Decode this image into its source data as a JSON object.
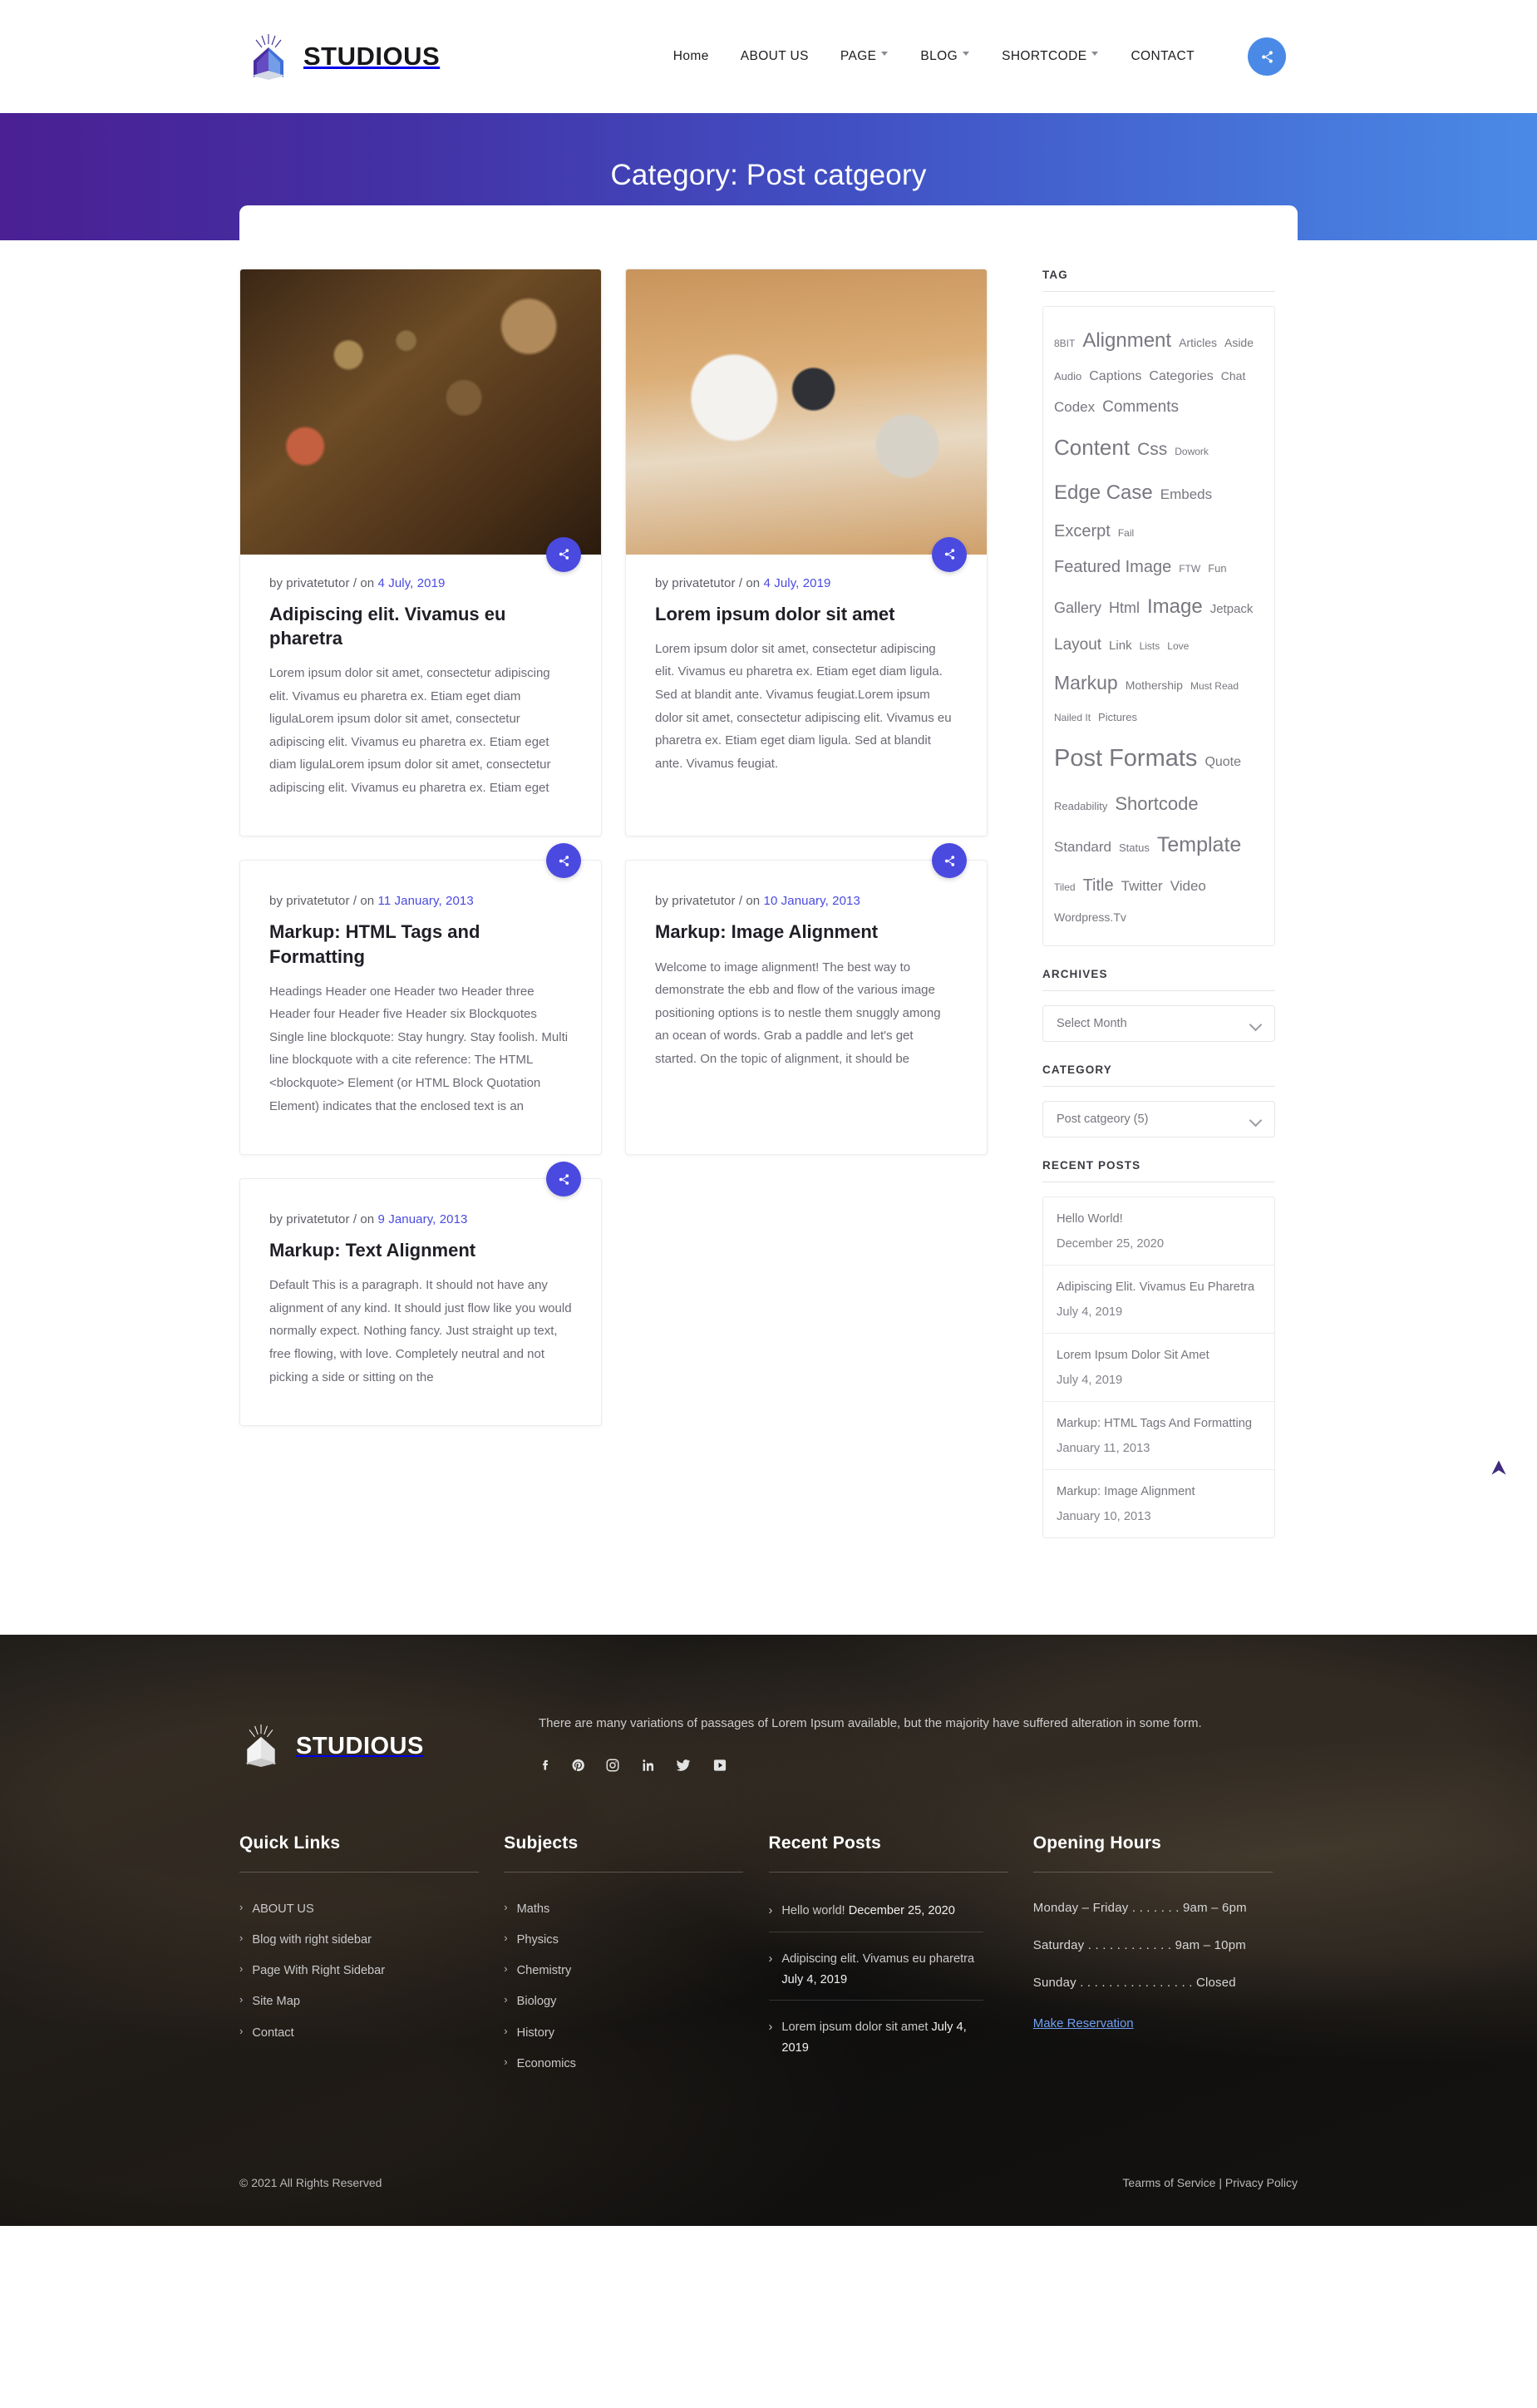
{
  "header": {
    "brand": "STUDIOUS",
    "nav": [
      {
        "label": "Home",
        "caret": false
      },
      {
        "label": "ABOUT US",
        "caret": false
      },
      {
        "label": "PAGE",
        "caret": true
      },
      {
        "label": "BLOG",
        "caret": true
      },
      {
        "label": "SHORTCODE",
        "caret": true
      },
      {
        "label": "CONTACT",
        "caret": false
      }
    ],
    "share_icon": "share-icon"
  },
  "hero": {
    "title": "Category: Post catgeory"
  },
  "posts": [
    {
      "meta_by": "by privatetutor / on ",
      "date": "4 July, 2019",
      "title": "Adipiscing elit. Vivamus eu pharetra",
      "excerpt": "Lorem ipsum dolor sit amet, consectetur adipiscing elit. Vivamus eu pharetra ex. Etiam eget diam ligulaLorem ipsum dolor sit amet, consectetur adipiscing elit. Vivamus eu pharetra ex. Etiam eget diam ligulaLorem ipsum dolor sit amet, consectetur adipiscing elit. Vivamus eu pharetra ex. Etiam eget",
      "has_image": true,
      "image_kind": "engine-room-photo"
    },
    {
      "meta_by": "by privatetutor / on ",
      "date": "4 July, 2019",
      "title": "Lorem ipsum dolor sit amet",
      "excerpt": "Lorem ipsum dolor sit amet, consectetur adipiscing elit. Vivamus eu pharetra ex. Etiam eget diam ligula. Sed at blandit ante. Vivamus feugiat.Lorem ipsum dolor sit amet, consectetur adipiscing elit. Vivamus eu pharetra ex. Etiam eget diam ligula. Sed at blandit ante. Vivamus feugiat.",
      "has_image": true,
      "image_kind": "desk-workspace-photo"
    },
    {
      "meta_by": "by privatetutor / on ",
      "date": "11 January, 2013",
      "title": "Markup: HTML Tags and Formatting",
      "excerpt": "Headings Header one Header two Header three Header four Header five Header six Blockquotes Single line blockquote: Stay hungry. Stay foolish. Multi line blockquote with a cite reference: The HTML <blockquote> Element (or HTML Block Quotation Element) indicates that the enclosed text is an",
      "has_image": false,
      "image_kind": ""
    },
    {
      "meta_by": "by privatetutor / on ",
      "date": "10 January, 2013",
      "title": "Markup: Image Alignment",
      "excerpt": "Welcome to image alignment! The best way to demonstrate the ebb and flow of the various image positioning options is to nestle them snuggly among an ocean of words. Grab a paddle and let's get started. On the topic of alignment, it should be",
      "has_image": false,
      "image_kind": ""
    },
    {
      "meta_by": "by privatetutor / on ",
      "date": "9 January, 2013",
      "title": "Markup: Text Alignment",
      "excerpt": "Default This is a paragraph. It should not have any alignment of any kind. It should just flow like you would normally expect. Nothing fancy. Just straight up text, free flowing, with love. Completely neutral and not picking a side or sitting on the",
      "has_image": false,
      "image_kind": ""
    }
  ],
  "sidebar": {
    "tag_widget_title": "TAG",
    "tags": [
      {
        "label": "8BIT",
        "size": 12
      },
      {
        "label": "Alignment",
        "size": 24
      },
      {
        "label": "Articles",
        "size": 14
      },
      {
        "label": "Aside",
        "size": 14
      },
      {
        "label": "Audio",
        "size": 13
      },
      {
        "label": "Captions",
        "size": 16
      },
      {
        "label": "Categories",
        "size": 16
      },
      {
        "label": "Chat",
        "size": 14
      },
      {
        "label": "Codex",
        "size": 17
      },
      {
        "label": "Comments",
        "size": 19
      },
      {
        "label": "Content",
        "size": 26
      },
      {
        "label": "Css",
        "size": 21
      },
      {
        "label": "Dowork",
        "size": 12
      },
      {
        "label": "Edge Case",
        "size": 24
      },
      {
        "label": "Embeds",
        "size": 17
      },
      {
        "label": "Excerpt",
        "size": 20
      },
      {
        "label": "Fail",
        "size": 12
      },
      {
        "label": "Featured Image",
        "size": 20
      },
      {
        "label": "FTW",
        "size": 12
      },
      {
        "label": "Fun",
        "size": 13
      },
      {
        "label": "Gallery",
        "size": 18
      },
      {
        "label": "Html",
        "size": 18
      },
      {
        "label": "Image",
        "size": 24
      },
      {
        "label": "Jetpack",
        "size": 15
      },
      {
        "label": "Layout",
        "size": 19
      },
      {
        "label": "Link",
        "size": 15
      },
      {
        "label": "Lists",
        "size": 12
      },
      {
        "label": "Love",
        "size": 12
      },
      {
        "label": "Markup",
        "size": 23
      },
      {
        "label": "Mothership",
        "size": 14
      },
      {
        "label": "Must Read",
        "size": 12
      },
      {
        "label": "Nailed It",
        "size": 12
      },
      {
        "label": "Pictures",
        "size": 13
      },
      {
        "label": "Post Formats",
        "size": 29
      },
      {
        "label": "Quote",
        "size": 16
      },
      {
        "label": "Readability",
        "size": 13
      },
      {
        "label": "Shortcode",
        "size": 22
      },
      {
        "label": "Standard",
        "size": 17
      },
      {
        "label": "Status",
        "size": 13
      },
      {
        "label": "Template",
        "size": 25
      },
      {
        "label": "Tiled",
        "size": 12
      },
      {
        "label": "Title",
        "size": 20
      },
      {
        "label": "Twitter",
        "size": 17
      },
      {
        "label": "Video",
        "size": 17
      },
      {
        "label": "Wordpress.Tv",
        "size": 14
      }
    ],
    "archives_title": "ARCHIVES",
    "archives_selected": "Select Month",
    "category_title": "CATEGORY",
    "category_selected": "Post catgeory  (5)",
    "recent_title": "RECENT POSTS",
    "recent_posts": [
      {
        "title": "Hello World!",
        "date": "December 25, 2020",
        "wrap": false
      },
      {
        "title": "Adipiscing Elit. Vivamus Eu Pharetra",
        "date": "July 4, 2019",
        "wrap": true
      },
      {
        "title": "Lorem Ipsum Dolor Sit Amet",
        "date": "July 4, 2019",
        "wrap": false
      },
      {
        "title": "Markup: HTML Tags And Formatting",
        "date": "January 11, 2013",
        "wrap": false
      },
      {
        "title": "Markup: Image Alignment",
        "date": "January 10, 2013",
        "wrap": false
      }
    ]
  },
  "footer": {
    "brand": "STUDIOUS",
    "about": "There are many variations of passages of Lorem Ipsum available, but the majority have suffered alteration in some form.",
    "socials": [
      "facebook-icon",
      "pinterest-icon",
      "instagram-icon",
      "linkedin-icon",
      "twitter-icon",
      "youtube-icon"
    ],
    "quick_links_title": "Quick Links",
    "quick_links": [
      "ABOUT US",
      "Blog with right sidebar",
      "Page With Right Sidebar",
      "Site Map",
      "Contact"
    ],
    "subjects_title": "Subjects",
    "subjects": [
      "Maths",
      "Physics",
      "Chemistry",
      "Biology",
      "History",
      "Economics"
    ],
    "recent_title": "Recent Posts",
    "recent": [
      {
        "title": "Hello world!",
        "date": "December 25, 2020"
      },
      {
        "title": "Adipiscing elit. Vivamus eu pharetra",
        "date": "July 4, 2019"
      },
      {
        "title": "Lorem ipsum dolor sit amet",
        "date": "July 4, 2019"
      }
    ],
    "hours_title": "Opening Hours",
    "hours": [
      "Monday – Friday . . . . . . . 9am – 6pm",
      "Saturday . . . . . . . . . . . . 9am – 10pm",
      "Sunday . . . . . . . . . . . . . . . . Closed"
    ],
    "reservation_label": "Make Reservation",
    "copyright": "© 2021 All Rights Reserved",
    "legal": "Tearms of Service | Privacy Policy"
  },
  "colors": {
    "accent_blue": "#4a8ae6",
    "share_purple": "#4a4ae0",
    "hero_gradient_start": "#4a2093",
    "hero_gradient_end": "#4a8ae6",
    "scroll_top_arrow": "#412a7e"
  }
}
